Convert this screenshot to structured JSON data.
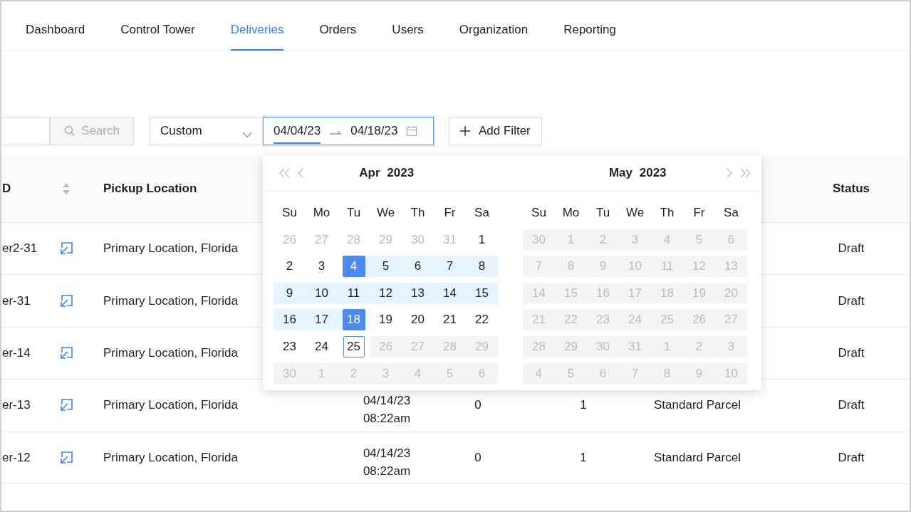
{
  "nav": [
    {
      "label": "Dashboard",
      "selected": false
    },
    {
      "label": "Control Tower",
      "selected": false
    },
    {
      "label": "Deliveries",
      "selected": true
    },
    {
      "label": "Orders",
      "selected": false
    },
    {
      "label": "Users",
      "selected": false
    },
    {
      "label": "Organization",
      "selected": false
    },
    {
      "label": "Reporting",
      "selected": false
    }
  ],
  "toolbar": {
    "search_button": {
      "label": "Search",
      "disabled": true
    },
    "range_select": {
      "value": "Custom"
    },
    "date_range": {
      "focused": true,
      "start": {
        "value": "04/04/23",
        "selected": true
      },
      "end": {
        "value": "04/18/23",
        "selected": false
      }
    },
    "add_filter_button": {
      "label": "Add Filter"
    }
  },
  "table": {
    "header": {
      "id": {
        "label": "D",
        "sortable": true
      },
      "pickup_location": {
        "label": "Pickup Location"
      },
      "status": {
        "label": "Status"
      }
    },
    "rows": [
      {
        "id": "er2-31",
        "pickup_location": "Primary Location, Florida",
        "status": "Draft"
      },
      {
        "id": "er-31",
        "pickup_location": "Primary Location, Florida",
        "status": "Draft"
      },
      {
        "id": "er-14",
        "pickup_location": "Primary Location, Florida",
        "status": "Draft"
      },
      {
        "id": "er-13",
        "pickup_location": "Primary Location, Florida",
        "column_4": "04/14/23 08:22am",
        "column_5": "0",
        "column_6": "1",
        "column_7": "Standard Parcel",
        "status": "Draft"
      },
      {
        "id": "er-12",
        "pickup_location": "Primary Location, Florida",
        "column_4": "04/14/23 08:22am",
        "column_5": "0",
        "column_6": "1",
        "column_7": "Standard Parcel",
        "status": "Draft"
      }
    ]
  },
  "calendar": {
    "months": [
      {
        "title": "Apr 2023",
        "weekdays": [
          "Su",
          "Mo",
          "Tu",
          "We",
          "Th",
          "Fr",
          "Sa"
        ],
        "weeks": [
          [
            {
              "day": "26",
              "kind": "outside"
            },
            {
              "day": "27",
              "kind": "outside"
            },
            {
              "day": "28",
              "kind": "outside"
            },
            {
              "day": "29",
              "kind": "outside"
            },
            {
              "day": "30",
              "kind": "outside"
            },
            {
              "day": "31",
              "kind": "outside"
            },
            {
              "day": "1",
              "kind": "day"
            }
          ],
          [
            {
              "day": "2",
              "kind": "day"
            },
            {
              "day": "3",
              "kind": "day"
            },
            {
              "day": "4",
              "kind": "start"
            },
            {
              "day": "5",
              "kind": "range"
            },
            {
              "day": "6",
              "kind": "range"
            },
            {
              "day": "7",
              "kind": "range"
            },
            {
              "day": "8",
              "kind": "range"
            }
          ],
          [
            {
              "day": "9",
              "kind": "range"
            },
            {
              "day": "10",
              "kind": "range"
            },
            {
              "day": "11",
              "kind": "range"
            },
            {
              "day": "12",
              "kind": "range"
            },
            {
              "day": "13",
              "kind": "range"
            },
            {
              "day": "14",
              "kind": "range"
            },
            {
              "day": "15",
              "kind": "range"
            }
          ],
          [
            {
              "day": "16",
              "kind": "range"
            },
            {
              "day": "17",
              "kind": "range"
            },
            {
              "day": "18",
              "kind": "end"
            },
            {
              "day": "19",
              "kind": "day"
            },
            {
              "day": "20",
              "kind": "day"
            },
            {
              "day": "21",
              "kind": "day"
            },
            {
              "day": "22",
              "kind": "day"
            }
          ],
          [
            {
              "day": "23",
              "kind": "day"
            },
            {
              "day": "24",
              "kind": "day"
            },
            {
              "day": "25",
              "kind": "today"
            },
            {
              "day": "26",
              "kind": "disabled"
            },
            {
              "day": "27",
              "kind": "disabled"
            },
            {
              "day": "28",
              "kind": "disabled"
            },
            {
              "day": "29",
              "kind": "disabled"
            }
          ],
          [
            {
              "day": "30",
              "kind": "disabled"
            },
            {
              "day": "1",
              "kind": "disabled"
            },
            {
              "day": "2",
              "kind": "disabled"
            },
            {
              "day": "3",
              "kind": "disabled"
            },
            {
              "day": "4",
              "kind": "disabled"
            },
            {
              "day": "5",
              "kind": "disabled"
            },
            {
              "day": "6",
              "kind": "disabled"
            }
          ]
        ]
      },
      {
        "title": "May 2023",
        "weekdays": [
          "Su",
          "Mo",
          "Tu",
          "We",
          "Th",
          "Fr",
          "Sa"
        ],
        "weeks": [
          [
            {
              "day": "30",
              "kind": "disabled"
            },
            {
              "day": "1",
              "kind": "disabled"
            },
            {
              "day": "2",
              "kind": "disabled"
            },
            {
              "day": "3",
              "kind": "disabled"
            },
            {
              "day": "4",
              "kind": "disabled"
            },
            {
              "day": "5",
              "kind": "disabled"
            },
            {
              "day": "6",
              "kind": "disabled"
            }
          ],
          [
            {
              "day": "7",
              "kind": "disabled"
            },
            {
              "day": "8",
              "kind": "disabled"
            },
            {
              "day": "9",
              "kind": "disabled"
            },
            {
              "day": "10",
              "kind": "disabled"
            },
            {
              "day": "11",
              "kind": "disabled"
            },
            {
              "day": "12",
              "kind": "disabled"
            },
            {
              "day": "13",
              "kind": "disabled"
            }
          ],
          [
            {
              "day": "14",
              "kind": "disabled"
            },
            {
              "day": "15",
              "kind": "disabled"
            },
            {
              "day": "16",
              "kind": "disabled"
            },
            {
              "day": "17",
              "kind": "disabled"
            },
            {
              "day": "18",
              "kind": "disabled"
            },
            {
              "day": "19",
              "kind": "disabled"
            },
            {
              "day": "20",
              "kind": "disabled"
            }
          ],
          [
            {
              "day": "21",
              "kind": "disabled"
            },
            {
              "day": "22",
              "kind": "disabled"
            },
            {
              "day": "23",
              "kind": "disabled"
            },
            {
              "day": "24",
              "kind": "disabled"
            },
            {
              "day": "25",
              "kind": "disabled"
            },
            {
              "day": "26",
              "kind": "disabled"
            },
            {
              "day": "27",
              "kind": "disabled"
            }
          ],
          [
            {
              "day": "28",
              "kind": "disabled"
            },
            {
              "day": "29",
              "kind": "disabled"
            },
            {
              "day": "30",
              "kind": "disabled"
            },
            {
              "day": "31",
              "kind": "disabled"
            },
            {
              "day": "1",
              "kind": "disabled"
            },
            {
              "day": "2",
              "kind": "disabled"
            },
            {
              "day": "3",
              "kind": "disabled"
            }
          ],
          [
            {
              "day": "4",
              "kind": "disabled"
            },
            {
              "day": "5",
              "kind": "disabled"
            },
            {
              "day": "6",
              "kind": "disabled"
            },
            {
              "day": "7",
              "kind": "disabled"
            },
            {
              "day": "8",
              "kind": "disabled"
            },
            {
              "day": "9",
              "kind": "disabled"
            },
            {
              "day": "10",
              "kind": "disabled"
            }
          ]
        ]
      }
    ]
  }
}
